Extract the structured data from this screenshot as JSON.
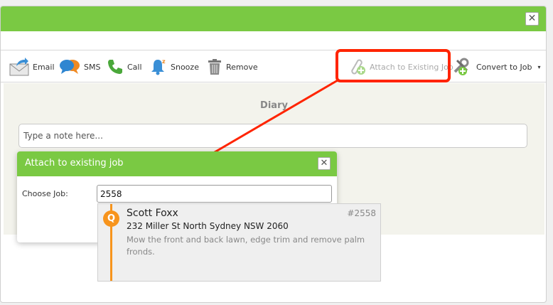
{
  "window": {
    "close_glyph": "✕"
  },
  "toolbar": {
    "email": {
      "label": "Email",
      "icon": "email-icon"
    },
    "sms": {
      "label": "SMS",
      "icon": "sms-bubbles-icon"
    },
    "call": {
      "label": "Call",
      "icon": "phone-icon"
    },
    "snooze": {
      "label": "Snooze",
      "icon": "bell-snooze-icon"
    },
    "remove": {
      "label": "Remove",
      "icon": "trash-icon"
    },
    "attach": {
      "label": "Attach to Existing Job",
      "icon": "paperclip-add-icon",
      "enabled": false
    },
    "convert": {
      "label": "Convert to Job",
      "icon": "tools-add-icon",
      "caret": "▾"
    }
  },
  "diary": {
    "title": "Diary",
    "note_placeholder": "Type a note here..."
  },
  "attach_dialog": {
    "title": "Attach to existing job",
    "close_glyph": "✕",
    "choose_label": "Choose Job:",
    "choose_value": "2558"
  },
  "suggestion": {
    "badge": "Q",
    "name": "Scott Foxx",
    "job_number": "#2558",
    "address": "232 Miller St North Sydney NSW 2060",
    "description": "Mow the front and back lawn, edge trim and remove palm fronds."
  },
  "colors": {
    "brand_green": "#7ac943",
    "highlight_red": "#ff2400",
    "quote_orange": "#f7941d"
  }
}
